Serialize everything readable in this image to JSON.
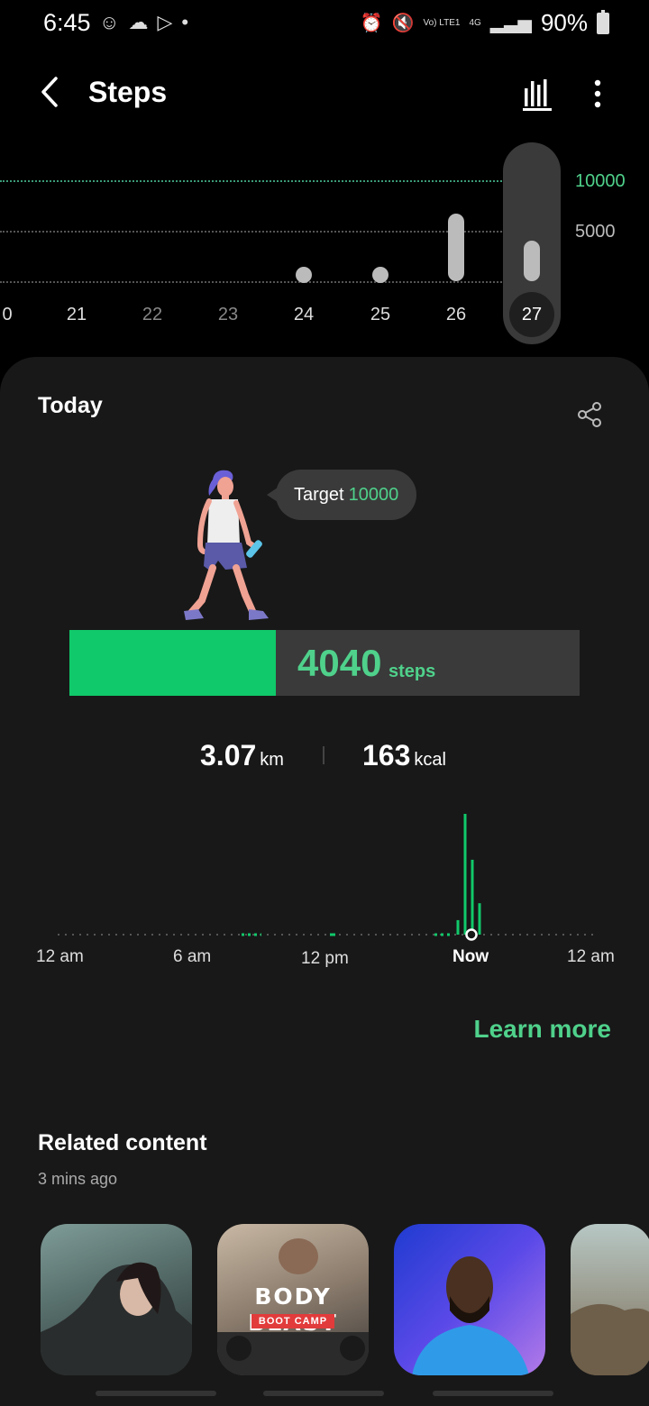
{
  "status_bar": {
    "time": "6:45",
    "left_icons": [
      "accessibility-icon",
      "snapchat-icon",
      "play-store-icon",
      "dot-icon"
    ],
    "network_label": "Vo) LTE1",
    "network_type": "4G",
    "battery": "90%"
  },
  "header": {
    "title": "Steps"
  },
  "week_chart": {
    "goal_label": "10000",
    "mid_label": "5000",
    "days": [
      {
        "label": "0",
        "state": "normal",
        "value": 0,
        "shape": "none"
      },
      {
        "label": "21",
        "state": "normal",
        "value": 0,
        "shape": "none"
      },
      {
        "label": "22",
        "state": "dim",
        "value": 0,
        "shape": "none"
      },
      {
        "label": "23",
        "state": "dim",
        "value": 0,
        "shape": "none"
      },
      {
        "label": "24",
        "state": "normal",
        "value": 0,
        "shape": "dot"
      },
      {
        "label": "25",
        "state": "normal",
        "value": 0,
        "shape": "dot"
      },
      {
        "label": "26",
        "state": "normal",
        "value": 6700,
        "shape": "bar"
      },
      {
        "label": "27",
        "state": "selected",
        "value": 4040,
        "shape": "bar"
      }
    ]
  },
  "today": {
    "title": "Today",
    "target_label": "Target",
    "target_value": "10000",
    "steps_value": "4040",
    "steps_unit": "steps",
    "progress_fraction": 0.404,
    "distance_value": "3.07",
    "distance_unit": "km",
    "calories_value": "163",
    "calories_unit": "kcal",
    "time_labels": [
      "12 am",
      "6 am",
      "12 pm",
      "Now",
      "12 am"
    ],
    "hourly_bars": [
      0.12,
      1.0,
      0.62,
      0.26
    ],
    "learn_more": "Learn more"
  },
  "related": {
    "title": "Related content",
    "updated": "3 mins ago",
    "thumb_2_title": "BODY BLAST",
    "thumb_2_subtitle": "BOOT CAMP"
  },
  "colors": {
    "accent": "#4fd18b",
    "progress": "#10c96a",
    "card": "#181818",
    "track": "#3a3a3a"
  }
}
